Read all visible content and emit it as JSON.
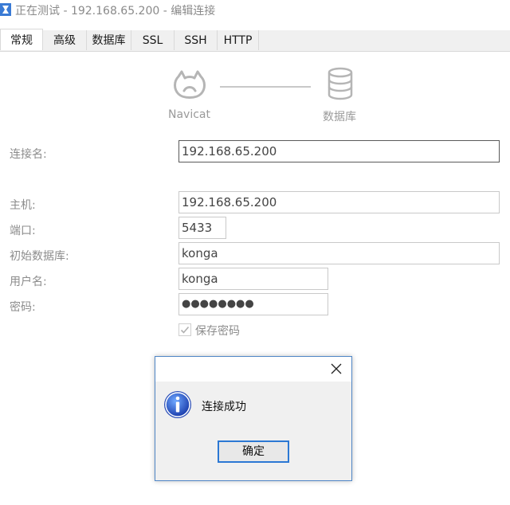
{
  "window": {
    "title": "正在测试 - 192.168.65.200 - 编辑连接",
    "icon": "navicat-app-icon"
  },
  "tabs": [
    {
      "label": "常规",
      "active": true
    },
    {
      "label": "高级",
      "active": false
    },
    {
      "label": "数据库",
      "active": false
    },
    {
      "label": "SSL",
      "active": false
    },
    {
      "label": "SSH",
      "active": false
    },
    {
      "label": "HTTP",
      "active": false
    }
  ],
  "diagram": {
    "left_caption": "Navicat",
    "right_caption": "数据库",
    "left_icon": "navicat-logo-icon",
    "right_icon": "database-icon"
  },
  "form": {
    "connection_name": {
      "label": "连接名:",
      "value": "192.168.65.200"
    },
    "host": {
      "label": "主机:",
      "value": "192.168.65.200"
    },
    "port": {
      "label": "端口:",
      "value": "5433"
    },
    "initial_database": {
      "label": "初始数据库:",
      "value": "konga"
    },
    "username": {
      "label": "用户名:",
      "value": "konga"
    },
    "password": {
      "label": "密码:",
      "value": "●●●●●●●●"
    },
    "save_password": {
      "label": "保存密码",
      "checked": true
    }
  },
  "dialog": {
    "message": "连接成功",
    "ok_label": "确定",
    "icon": "info-icon",
    "close_icon": "close-icon"
  },
  "colors": {
    "accent": "#2b78d4",
    "dialog_border": "#4f86c6"
  }
}
